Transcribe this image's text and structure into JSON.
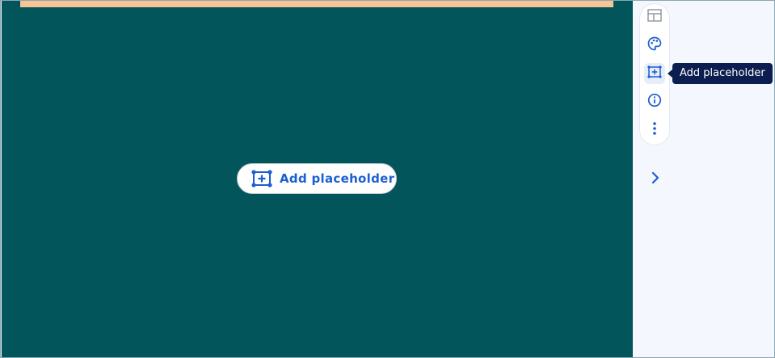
{
  "canvas": {
    "add_button": {
      "label": "Add placeholder",
      "icon": "add-placeholder-icon"
    }
  },
  "sidebar": {
    "tools": [
      {
        "name": "layout",
        "icon": "layout-icon",
        "active": false
      },
      {
        "name": "theme",
        "icon": "palette-icon",
        "active": false
      },
      {
        "name": "add-placeholder",
        "icon": "add-placeholder-icon",
        "active": true
      },
      {
        "name": "info",
        "icon": "info-icon",
        "active": false
      },
      {
        "name": "more",
        "icon": "more-vertical-icon",
        "active": false
      }
    ],
    "tooltip": "Add placeholder",
    "expand_icon": "chevron-right-icon"
  },
  "colors": {
    "canvas_bg": "#02565b",
    "topbar": "#f7c496",
    "accent": "#1b5fd1",
    "tooltip_bg": "#0b1e4f",
    "sidebar_bg": "#f4f7fd"
  }
}
